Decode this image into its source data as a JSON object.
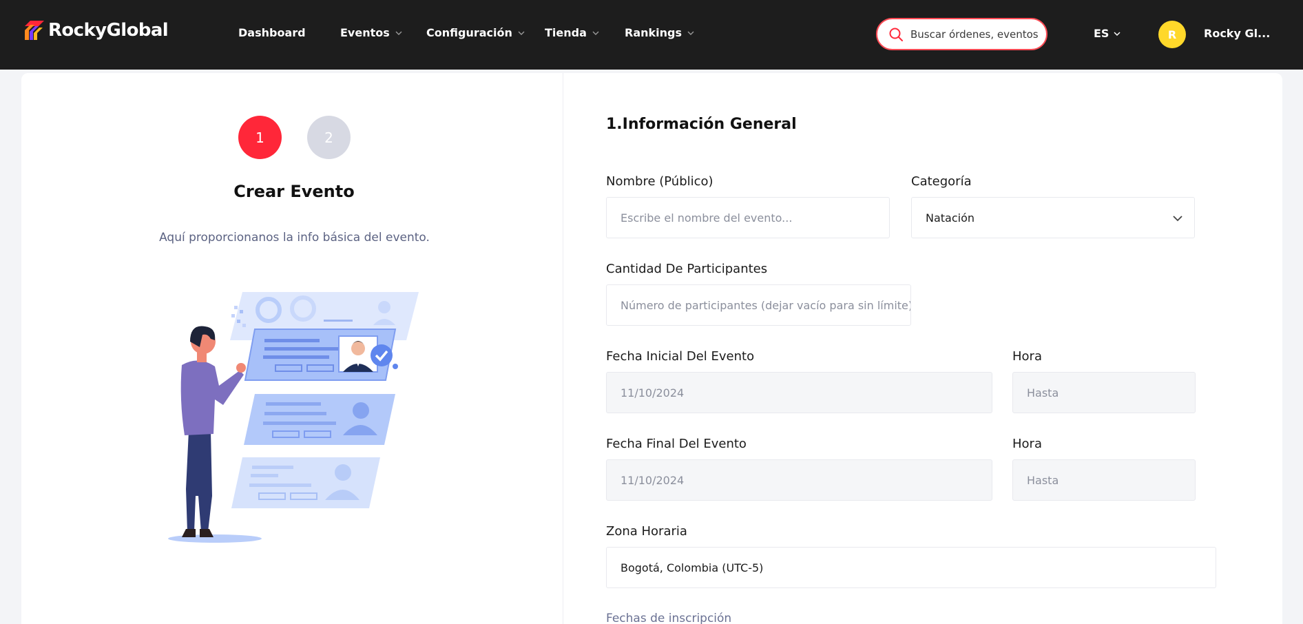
{
  "brand": {
    "name": "RockyGlobal"
  },
  "nav": {
    "items": [
      {
        "label": "Dashboard",
        "has_dropdown": false
      },
      {
        "label": "Eventos",
        "has_dropdown": true
      },
      {
        "label": "Configuración",
        "has_dropdown": true
      },
      {
        "label": "Tienda",
        "has_dropdown": true
      },
      {
        "label": "Rankings",
        "has_dropdown": true
      }
    ]
  },
  "search": {
    "placeholder": "Buscar órdenes, eventos"
  },
  "language": {
    "value": "ES"
  },
  "user": {
    "initial": "R",
    "name": "Rocky Gl..."
  },
  "steps": {
    "step1": "1",
    "step2": "2",
    "active": 1
  },
  "left_panel": {
    "title": "Crear Evento",
    "description": "Aquí proporcionanos la info básica del evento."
  },
  "form": {
    "section_title": "1.Información General",
    "name": {
      "label": "Nombre (Público)",
      "placeholder": "Escribe el nombre del evento..."
    },
    "category": {
      "label": "Categoría",
      "value": "Natación"
    },
    "participants": {
      "label": "Cantidad De Participantes",
      "placeholder": "Número de participantes (dejar vacío para sin límite)"
    },
    "start_date": {
      "label": "Fecha Inicial Del Evento",
      "placeholder": "11/10/2024"
    },
    "start_time": {
      "label": "Hora",
      "placeholder": "Hasta"
    },
    "end_date": {
      "label": "Fecha Final Del Evento",
      "placeholder": "11/10/2024"
    },
    "end_time": {
      "label": "Hora",
      "placeholder": "Hasta"
    },
    "timezone": {
      "label": "Zona Horaria",
      "value": "Bogotá, Colombia (UTC-5)"
    },
    "registration_dates_label": "Fechas de inscripción"
  },
  "colors": {
    "topbar": "#1d1d1d",
    "accent": "#ff2739",
    "step_inactive": "#d7d9e3",
    "avatar": "#ffd82a"
  }
}
